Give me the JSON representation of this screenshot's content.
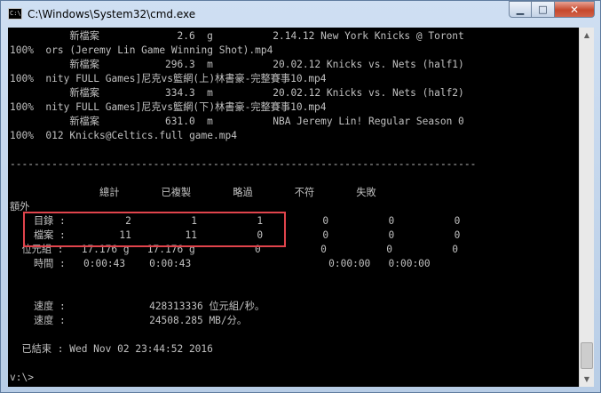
{
  "window": {
    "title": "C:\\Windows\\System32\\cmd.exe",
    "icon_label": "C:\\",
    "buttons": {
      "minimize": "▁",
      "maximize": "□",
      "close": "✕"
    }
  },
  "console": {
    "lines": [
      "          新檔案             2.6  g          2.14.12 New York Knicks @ Toront",
      "100%  ors (Jeremy Lin Game Winning Shot).mp4",
      "          新檔案           296.3  m          20.02.12 Knicks vs. Nets (half1)",
      "100%  nity FULL Games]尼克vs籃網(上)林書豪-完整賽事10.mp4",
      "          新檔案           334.3  m          20.02.12 Knicks vs. Nets (half2)",
      "100%  nity FULL Games]尼克vs籃網(下)林書豪-完整賽事10.mp4",
      "          新檔案           631.0  m          NBA Jeremy Lin! Regular Season 0",
      "100%  012 Knicks@Celtics.full game.mp4",
      "",
      "",
      "------------------------------------------------------------------------------",
      "",
      "               總計       已複製       略過       不符       失敗",
      "額外",
      "    目錄 :          2          1          1          0          0          0",
      "    檔案 :         11         11          0          0          0          0",
      "  位元組 :   17.176 g   17.176 g          0          0          0          0",
      "    時間 :   0:00:43    0:00:43                       0:00:00   0:00:00",
      "",
      "",
      "    速度 :              428313336 位元組/秒。",
      "    速度 :              24508.285 MB/分。",
      "",
      "  已結束 : Wed Nov 02 23:44:52 2016",
      "",
      "v:\\>"
    ]
  },
  "scrollbar": {
    "up": "▲",
    "down": "▼"
  }
}
